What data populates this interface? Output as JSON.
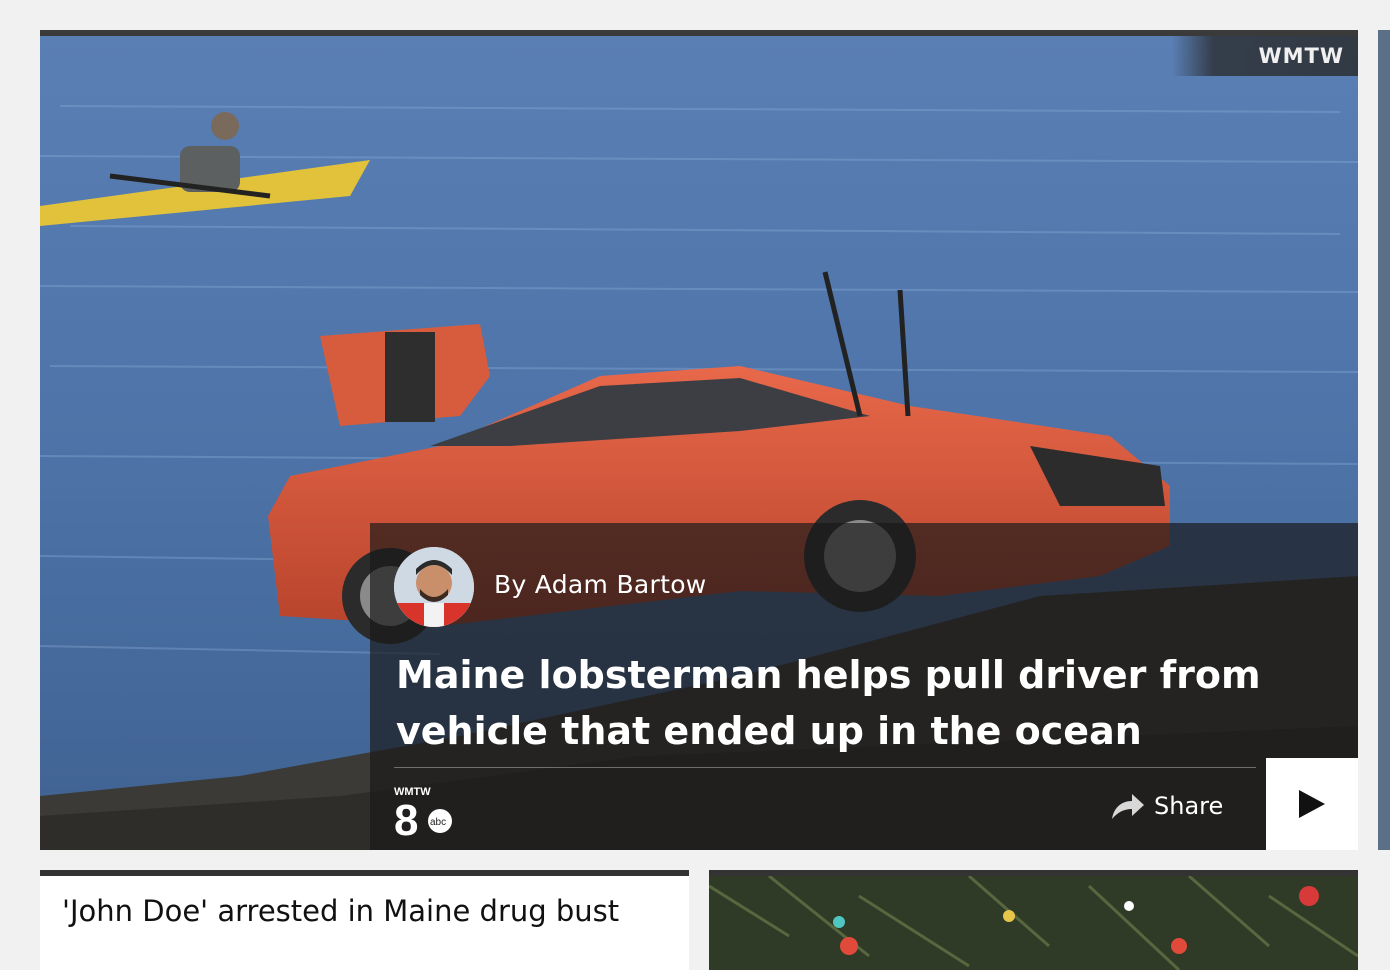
{
  "hero": {
    "photo_credit": "WMTW",
    "author": "By Adam Bartow",
    "headline": "Maine lobsterman helps pull driver from vehicle that ended up in the ocean",
    "share_label": "Share",
    "station_logo_top": "WMTW",
    "station_logo_channel": "8",
    "station_logo_network": "abc"
  },
  "cards": [
    {
      "title": "'John Doe' arrested in Maine drug bust"
    }
  ],
  "icons": {
    "share": "share-arrow-icon",
    "play": "play-icon"
  }
}
